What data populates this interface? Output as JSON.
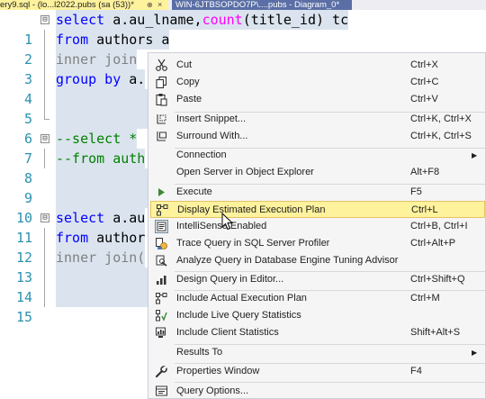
{
  "tabs": {
    "active": "ery9.sql - (lo...l2022.pubs (sa (53))*",
    "active_pin": "⊕",
    "active_close": "×",
    "other": "WIN-6JTBSOPDO7P\\....pubs - Diagram_0*"
  },
  "editor": {
    "line_numbers": [
      "1",
      "2",
      "3",
      "4",
      "5",
      "6",
      "7",
      "8",
      "9",
      "10",
      "11",
      "12",
      "13",
      "14",
      "15"
    ],
    "l1": {
      "kw": "select",
      "a": " a.au_lname,",
      "fn": "count",
      "b": "(title_id) tc"
    },
    "l2": {
      "kw": "from",
      "a": " authors a"
    },
    "l3": {
      "gr": "inner join"
    },
    "l4": {
      "kw": "group by",
      "a": " a."
    },
    "l7": {
      "cm": "--select *"
    },
    "l8": {
      "cm": "--from auth"
    },
    "l11": {
      "kw": "select",
      "a": " a.au"
    },
    "l12": {
      "kw": "from",
      "a": " author"
    },
    "l13": {
      "gr": "inner join("
    },
    "collapse_glyph": "⊟"
  },
  "menu": {
    "items": [
      {
        "label": "Cut",
        "shortcut": "Ctrl+X",
        "icon": "scissors-icon"
      },
      {
        "label": "Copy",
        "shortcut": "Ctrl+C",
        "icon": "copy-icon"
      },
      {
        "label": "Paste",
        "shortcut": "Ctrl+V",
        "icon": "paste-icon"
      },
      {
        "label": "Insert Snippet...",
        "shortcut": "Ctrl+K, Ctrl+X",
        "icon": "snippet-icon"
      },
      {
        "label": "Surround With...",
        "shortcut": "Ctrl+K, Ctrl+S",
        "icon": "surround-icon"
      },
      {
        "label": "Connection",
        "shortcut": "",
        "icon": ""
      },
      {
        "label": "Open Server in Object Explorer",
        "shortcut": "Alt+F8",
        "icon": ""
      },
      {
        "label": "Execute",
        "shortcut": "F5",
        "icon": "play-icon"
      },
      {
        "label": "Display Estimated Execution Plan",
        "shortcut": "Ctrl+L",
        "icon": "plan-icon"
      },
      {
        "label": "IntelliSense Enabled",
        "shortcut": "Ctrl+B, Ctrl+I",
        "icon": "intellisense-icon"
      },
      {
        "label": "Trace Query in SQL Server Profiler",
        "shortcut": "Ctrl+Alt+P",
        "icon": "profiler-icon"
      },
      {
        "label": "Analyze Query in Database Engine Tuning Advisor",
        "shortcut": "",
        "icon": "tuning-icon"
      },
      {
        "label": "Design Query in Editor...",
        "shortcut": "Ctrl+Shift+Q",
        "icon": "design-query-icon"
      },
      {
        "label": "Include Actual Execution Plan",
        "shortcut": "Ctrl+M",
        "icon": "actual-plan-icon"
      },
      {
        "label": "Include Live Query Statistics",
        "shortcut": "",
        "icon": "live-stats-icon"
      },
      {
        "label": "Include Client Statistics",
        "shortcut": "Shift+Alt+S",
        "icon": "client-stats-icon"
      },
      {
        "label": "Results To",
        "shortcut": "",
        "icon": ""
      },
      {
        "label": "Properties Window",
        "shortcut": "F4",
        "icon": "wrench-icon"
      },
      {
        "label": "Query Options...",
        "shortcut": "",
        "icon": "query-options-icon"
      }
    ],
    "submenu_arrow": "▶",
    "highlighted_index": 8
  },
  "colors": {
    "keyword": "#0000ff",
    "function": "#ff00ff",
    "comment": "#008000",
    "gray": "#808080",
    "line_number": "#2b91af",
    "selection": "#dbe4ee",
    "menu_highlight": "#fff29d",
    "tab_inactive": "#5b6fa6"
  }
}
